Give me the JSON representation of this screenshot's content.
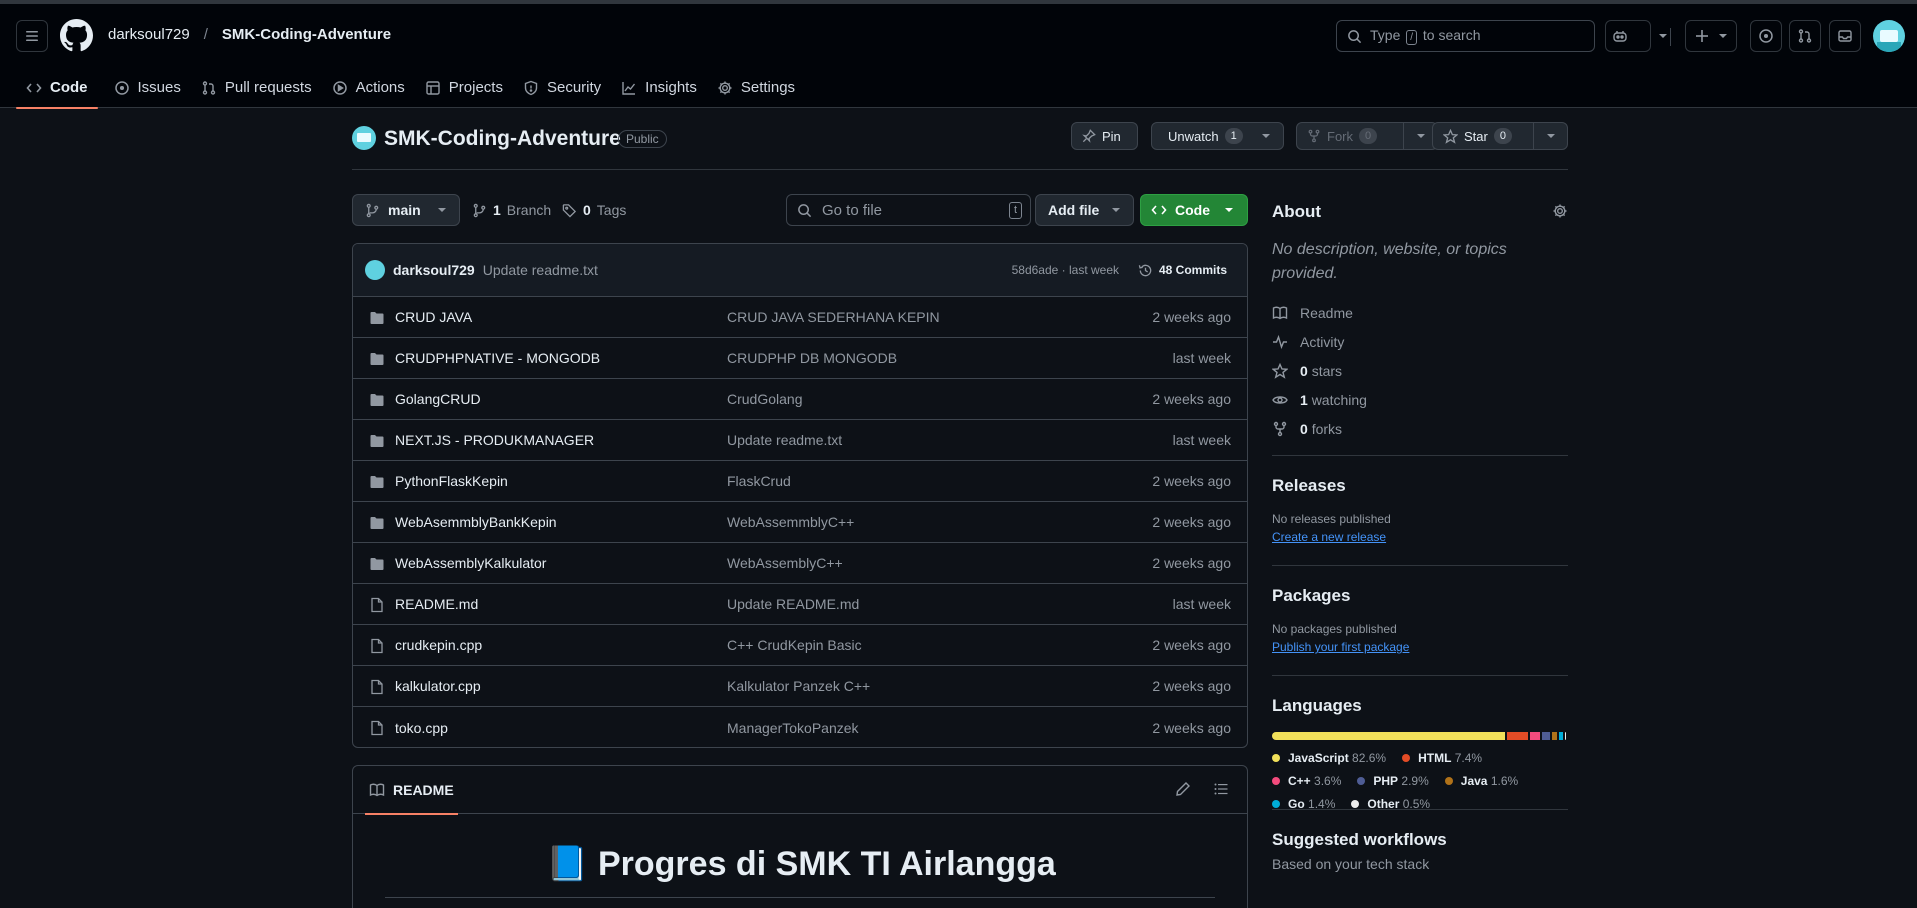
{
  "header": {
    "owner": "darksoul729",
    "separator": "/",
    "repo": "SMK-Coding-Adventure",
    "search_prefix": "Type",
    "search_key": "/",
    "search_suffix": "to search"
  },
  "nav": [
    {
      "label": "Code",
      "icon": "code-icon",
      "active": true
    },
    {
      "label": "Issues",
      "icon": "issue-icon"
    },
    {
      "label": "Pull requests",
      "icon": "pull-request-icon"
    },
    {
      "label": "Actions",
      "icon": "play-icon"
    },
    {
      "label": "Projects",
      "icon": "table-icon"
    },
    {
      "label": "Security",
      "icon": "shield-icon"
    },
    {
      "label": "Insights",
      "icon": "graph-icon"
    },
    {
      "label": "Settings",
      "icon": "gear-icon"
    }
  ],
  "repo": {
    "name": "SMK-Coding-Adventure",
    "visibility": "Public",
    "pin_label": "Pin",
    "unwatch_label": "Unwatch",
    "watch_count": "1",
    "fork_label": "Fork",
    "fork_count": "0",
    "star_label": "Star",
    "star_count": "0"
  },
  "toolbar": {
    "branch": "main",
    "branch_count": "1",
    "branch_label": "Branch",
    "tag_count": "0",
    "tag_label": "Tags",
    "goto_placeholder": "Go to file",
    "goto_key": "t",
    "add_file": "Add file",
    "code": "Code"
  },
  "commit": {
    "user": "darksoul729",
    "message": "Update readme.txt",
    "meta": "58d6ade · last week",
    "commits": "48 Commits"
  },
  "files": [
    {
      "type": "dir",
      "name": "CRUD JAVA",
      "message": "CRUD JAVA SEDERHANA KEPIN",
      "date": "2 weeks ago"
    },
    {
      "type": "dir",
      "name": "CRUDPHPNATIVE - MONGODB",
      "message": "CRUDPHP DB MONGODB",
      "date": "last week"
    },
    {
      "type": "dir",
      "name": "GolangCRUD",
      "message": "CrudGolang",
      "date": "2 weeks ago"
    },
    {
      "type": "dir",
      "name": "NEXT.JS - PRODUKMANAGER",
      "message": "Update readme.txt",
      "date": "last week"
    },
    {
      "type": "dir",
      "name": "PythonFlaskKepin",
      "message": "FlaskCrud",
      "date": "2 weeks ago"
    },
    {
      "type": "dir",
      "name": "WebAsemmblyBankKepin",
      "message": "WebAssemmblyC++",
      "date": "2 weeks ago"
    },
    {
      "type": "dir",
      "name": "WebAssemblyKalkulator",
      "message": "WebAssemblyC++",
      "date": "2 weeks ago"
    },
    {
      "type": "file",
      "name": "README.md",
      "message": "Update README.md",
      "date": "last week"
    },
    {
      "type": "file",
      "name": "crudkepin.cpp",
      "message": "C++ CrudKepin Basic",
      "date": "2 weeks ago"
    },
    {
      "type": "file",
      "name": "kalkulator.cpp",
      "message": "Kalkulator Panzek C++",
      "date": "2 weeks ago"
    },
    {
      "type": "file",
      "name": "toko.cpp",
      "message": "ManagerTokoPanzek",
      "date": "2 weeks ago"
    }
  ],
  "readme": {
    "tab": "README",
    "title": "📘 Progres di SMK TI Airlangga"
  },
  "about": {
    "heading": "About",
    "description": "No description, website, or topics provided.",
    "items": [
      {
        "icon": "book-icon",
        "count": "",
        "label": "Readme"
      },
      {
        "icon": "pulse-icon",
        "count": "",
        "label": "Activity"
      },
      {
        "icon": "star-icon",
        "count": "0",
        "label": "stars"
      },
      {
        "icon": "eye-icon",
        "count": "1",
        "label": "watching"
      },
      {
        "icon": "fork-icon",
        "count": "0",
        "label": "forks"
      }
    ]
  },
  "releases": {
    "heading": "Releases",
    "empty": "No releases published",
    "link": "Create a new release"
  },
  "packages": {
    "heading": "Packages",
    "empty": "No packages published",
    "link": "Publish your first package"
  },
  "languages": {
    "heading": "Languages",
    "items": [
      {
        "name": "JavaScript",
        "percent": "82.6%",
        "value": 82.6,
        "color": "#f1e05a"
      },
      {
        "name": "HTML",
        "percent": "7.4%",
        "value": 7.4,
        "color": "#e34c26"
      },
      {
        "name": "C++",
        "percent": "3.6%",
        "value": 3.6,
        "color": "#f34b7d"
      },
      {
        "name": "PHP",
        "percent": "2.9%",
        "value": 2.9,
        "color": "#4F5D95"
      },
      {
        "name": "Java",
        "percent": "1.6%",
        "value": 1.6,
        "color": "#b07219"
      },
      {
        "name": "Go",
        "percent": "1.4%",
        "value": 1.4,
        "color": "#00ADD8"
      },
      {
        "name": "Other",
        "percent": "0.5%",
        "value": 0.5,
        "color": "#ededed"
      }
    ]
  },
  "workflows": {
    "heading": "Suggested workflows",
    "subtitle": "Based on your tech stack"
  }
}
